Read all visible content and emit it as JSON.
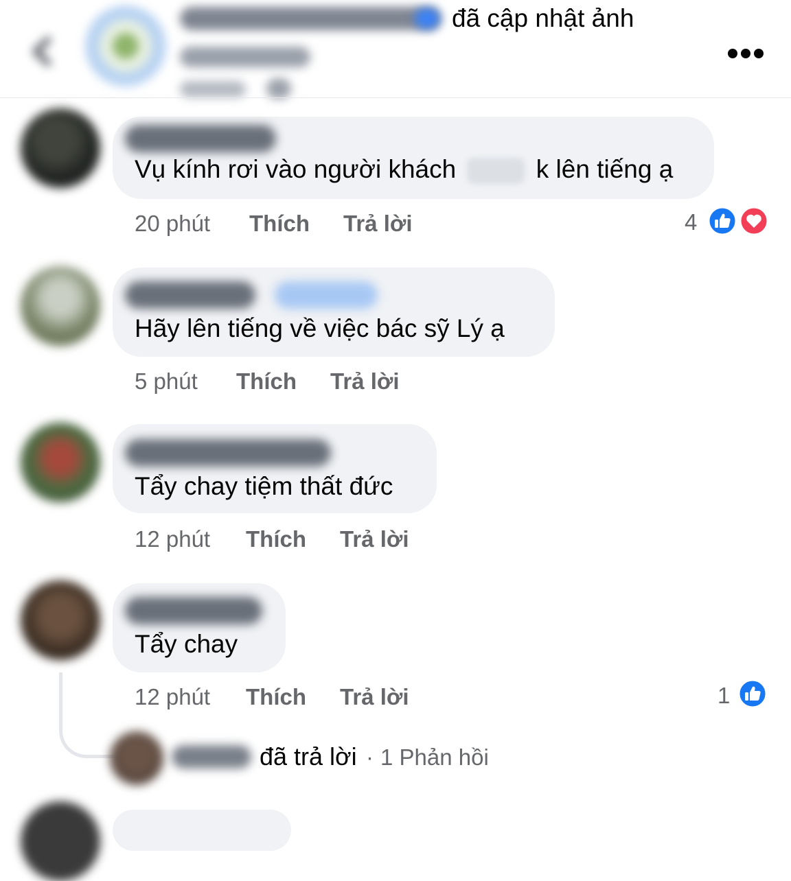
{
  "header": {
    "action_text": "đã cập nhật ảnh",
    "back_icon": "chevron-left-icon",
    "more_icon": "more-horizontal-icon"
  },
  "comments": [
    {
      "text_before": "Vụ kính rơi vào người khách",
      "text_after": "k lên tiếng ạ",
      "time": "20 phút",
      "like_label": "Thích",
      "reply_label": "Trả lời",
      "reaction_count": "4",
      "reactions": [
        "like-icon",
        "love-icon"
      ]
    },
    {
      "text": "Hãy lên tiếng về việc bác sỹ Lý ạ",
      "time": "5 phút",
      "like_label": "Thích",
      "reply_label": "Trả lời"
    },
    {
      "text": "Tẩy chay tiệm thất đức",
      "time": "12 phút",
      "like_label": "Thích",
      "reply_label": "Trả lời"
    },
    {
      "text": "Tẩy chay",
      "time": "12 phút",
      "like_label": "Thích",
      "reply_label": "Trả lời",
      "reaction_count": "1",
      "reactions": [
        "like-icon"
      ]
    }
  ],
  "reply_thread": {
    "action_text": "đã trả lời",
    "separator": "·",
    "count_text": "1 Phản hồi"
  },
  "colors": {
    "bubble": "#f0f2f5",
    "meta_text": "#65676b",
    "like_blue": "#1877f2",
    "love_red": "#f33e58"
  }
}
